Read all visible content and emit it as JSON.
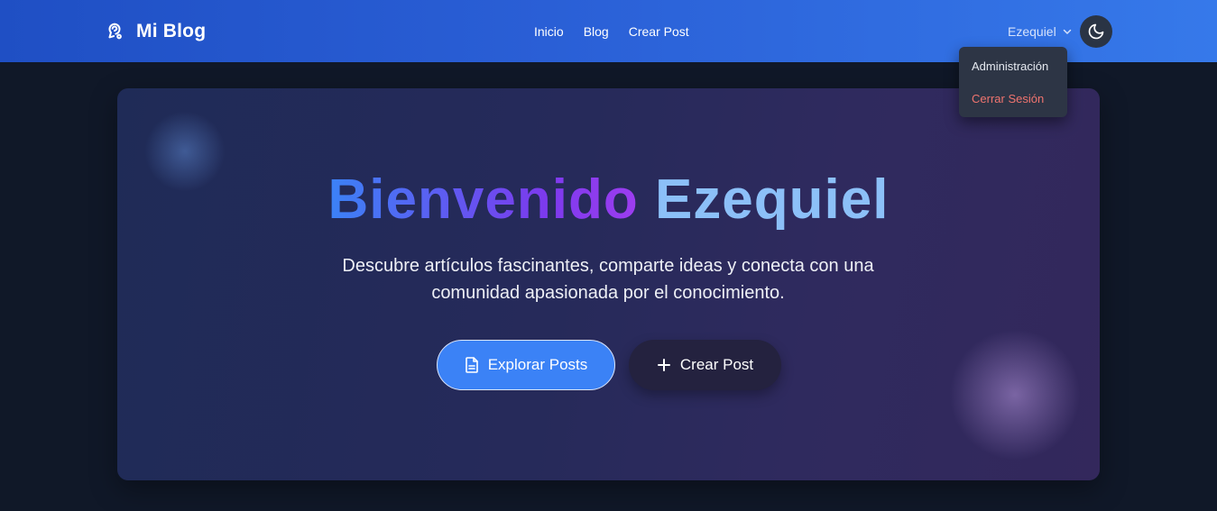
{
  "nav": {
    "brand": "Mi Blog",
    "brand_icon": "brain-icon",
    "links": [
      "Inicio",
      "Blog",
      "Crear Post"
    ],
    "user": "Ezequiel",
    "theme_icon": "moon-icon"
  },
  "dropdown": {
    "items": [
      "Administración",
      "Cerrar Sesión"
    ]
  },
  "hero": {
    "title_part1": "Bienvenido",
    "title_part2": "Ezequiel",
    "subtitle": "Descubre artículos fascinantes, comparte ideas y conecta con una comunidad apasionada por el conocimiento.",
    "primary_button": "Explorar Posts",
    "secondary_button": "Crear Post"
  },
  "colors": {
    "accent": "#3b82f6",
    "logout": "#f0746f",
    "background": "#101828"
  }
}
